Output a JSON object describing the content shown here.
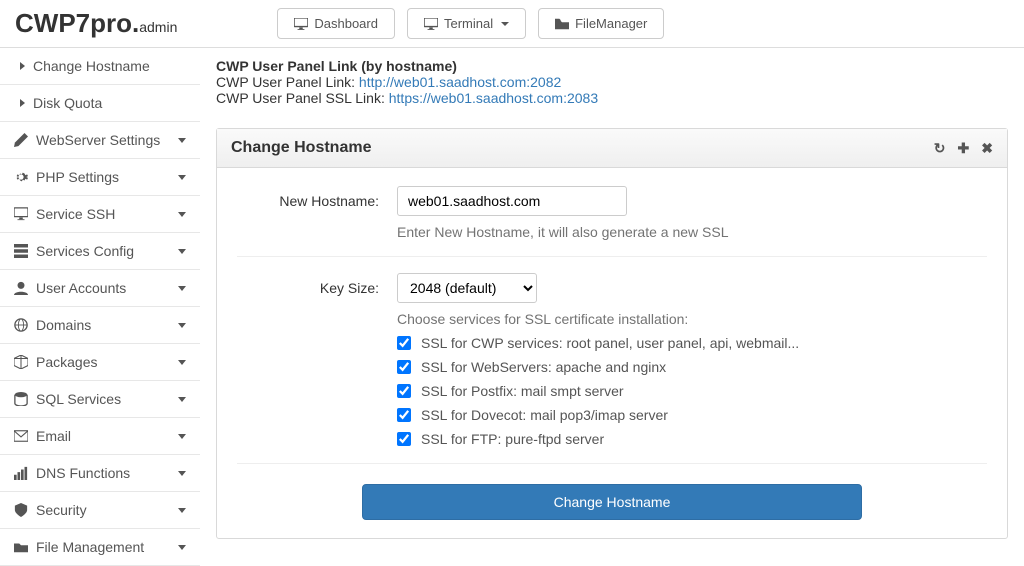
{
  "brand": {
    "main": "CWP7pro.",
    "sub": "admin"
  },
  "top": {
    "dashboard": "Dashboard",
    "terminal": "Terminal",
    "filemanager": "FileManager"
  },
  "sidebar": {
    "sub": [
      {
        "label": "Change Hostname"
      },
      {
        "label": "Disk Quota"
      }
    ],
    "items": [
      {
        "label": "WebServer Settings"
      },
      {
        "label": "PHP Settings"
      },
      {
        "label": "Service SSH"
      },
      {
        "label": "Services Config"
      },
      {
        "label": "User Accounts"
      },
      {
        "label": "Domains"
      },
      {
        "label": "Packages"
      },
      {
        "label": "SQL Services"
      },
      {
        "label": "Email"
      },
      {
        "label": "DNS Functions"
      },
      {
        "label": "Security"
      },
      {
        "label": "File Management"
      }
    ]
  },
  "info": {
    "title": "CWP User Panel Link (by hostname)",
    "line1_label": "CWP User Panel Link: ",
    "line1_link": "http://web01.saadhost.com:2082",
    "line2_label": "CWP User Panel SSL Link: ",
    "line2_link": "https://web01.saadhost.com:2083"
  },
  "panel": {
    "title": "Change Hostname",
    "hostname_label": "New Hostname:",
    "hostname_value": "web01.saadhost.com",
    "hostname_help": "Enter New Hostname, it will also generate a new SSL",
    "keysize_label": "Key Size:",
    "keysize_value": "2048 (default)",
    "services_help": "Choose services for SSL certificate installation:",
    "checks": [
      "SSL for CWP services: root panel, user panel, api, webmail...",
      "SSL for WebServers: apache and nginx",
      "SSL for Postfix: mail smpt server",
      "SSL for Dovecot: mail pop3/imap server",
      "SSL for FTP: pure-ftpd server"
    ],
    "submit": "Change Hostname"
  }
}
